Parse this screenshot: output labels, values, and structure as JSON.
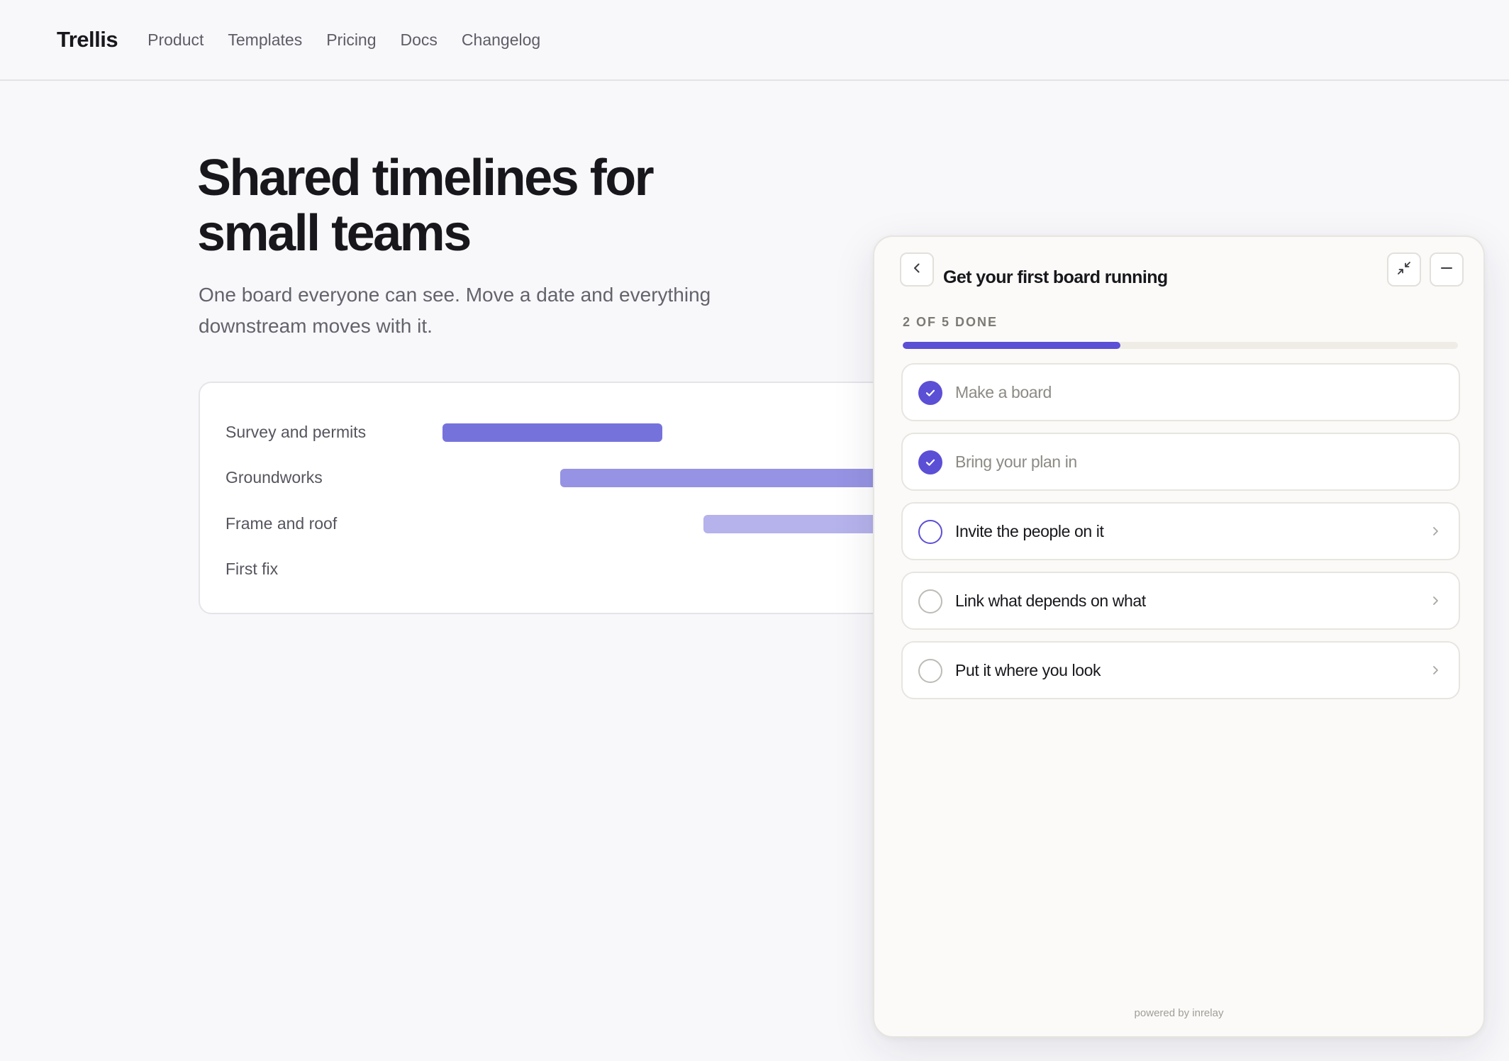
{
  "nav": {
    "brand": "Trellis",
    "links": [
      "Product",
      "Templates",
      "Pricing",
      "Docs",
      "Changelog"
    ]
  },
  "hero": {
    "title_line1": "Shared timelines for",
    "title_line2": "small teams",
    "subtitle": "One board everyone can see. Move a date and everything downstream moves with it."
  },
  "timeline": {
    "rows": [
      {
        "label": "Survey and permits",
        "color": "#7672dc"
      },
      {
        "label": "Groundworks",
        "color": "#9693e4"
      },
      {
        "label": "Frame and roof",
        "color": "#b5b2ec"
      },
      {
        "label": "First fix"
      }
    ]
  },
  "panel": {
    "title": "Get your first board running",
    "progress_label": "2 OF 5 DONE",
    "progress_fraction": 0.4,
    "accent": "#5b4fd6",
    "icons": {
      "back": "chevron-left-icon",
      "collapse": "collapse-arrows-icon",
      "minimize": "minus-icon"
    },
    "steps": [
      {
        "label": "Make a board",
        "state": "done"
      },
      {
        "label": "Bring your plan in",
        "state": "done"
      },
      {
        "label": "Invite the people on it",
        "state": "current"
      },
      {
        "label": "Link what depends on what",
        "state": "todo"
      },
      {
        "label": "Put it where you look",
        "state": "todo"
      }
    ],
    "footer": "powered by inrelay"
  }
}
